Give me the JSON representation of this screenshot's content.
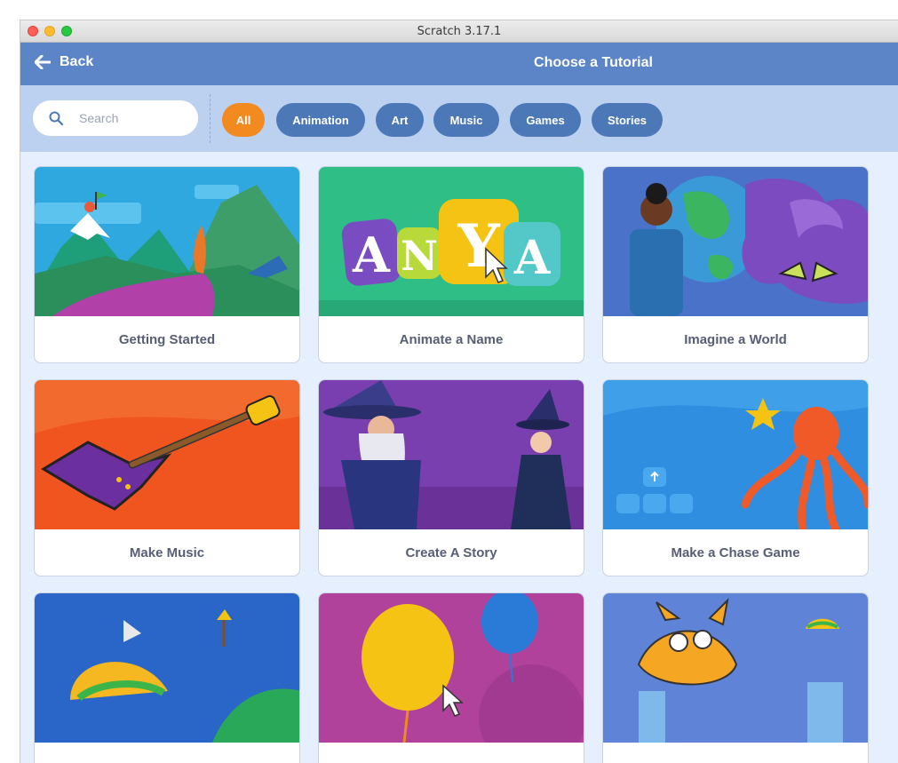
{
  "window": {
    "title": "Scratch 3.17.1"
  },
  "header": {
    "back_label": "Back",
    "title": "Choose a Tutorial"
  },
  "search": {
    "placeholder": "Search",
    "value": ""
  },
  "filters": [
    "All",
    "Animation",
    "Art",
    "Music",
    "Games",
    "Stories"
  ],
  "active_filter": "All",
  "tutorials": [
    {
      "title": "Getting Started"
    },
    {
      "title": "Animate a Name",
      "thumb_text": [
        "A",
        "N",
        "Y",
        "A"
      ]
    },
    {
      "title": "Imagine a World"
    },
    {
      "title": "Make Music"
    },
    {
      "title": "Create A Story"
    },
    {
      "title": "Make a Chase Game"
    },
    {
      "title": ""
    },
    {
      "title": ""
    },
    {
      "title": ""
    }
  ],
  "colors": {
    "header": "#5b85c7",
    "filter_bar": "#bcd1f0",
    "pill": "#4c78b8",
    "pill_active": "#f38a20",
    "background": "#e6effd",
    "card_label": "#575e75"
  }
}
